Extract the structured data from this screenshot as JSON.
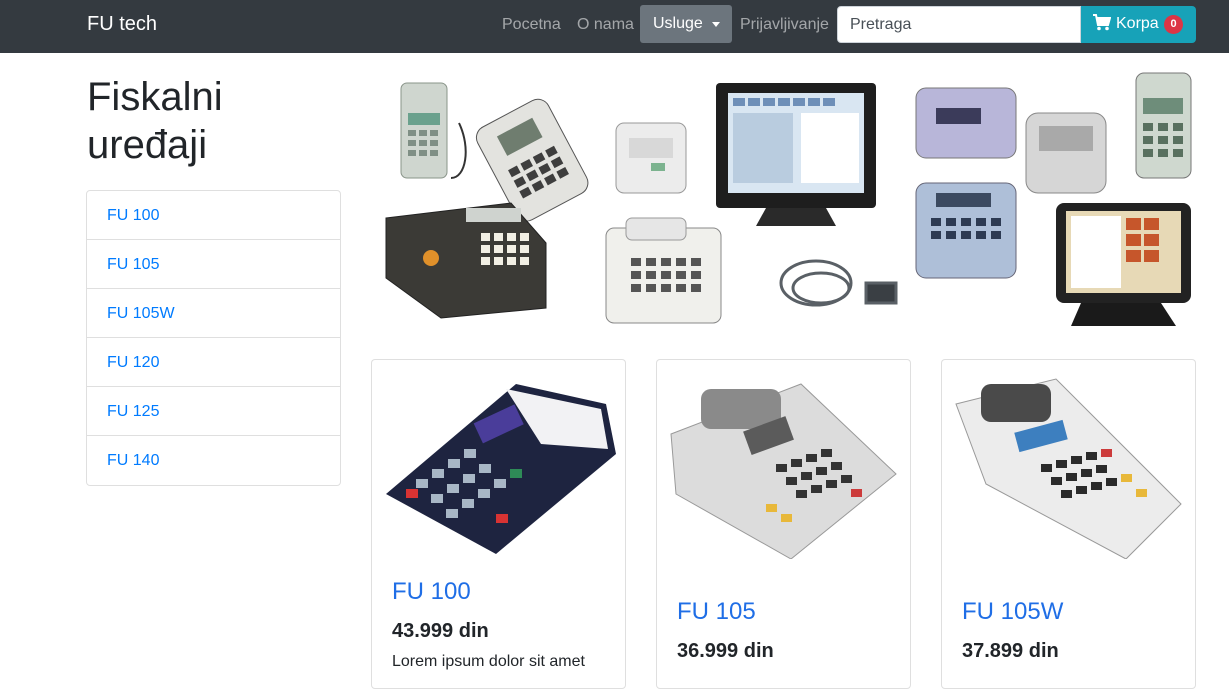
{
  "navbar": {
    "brand": "FU tech",
    "links": [
      "Pocetna",
      "O nama"
    ],
    "dropdown_label": "Usluge",
    "login_label": "Prijavljivanje",
    "search_placeholder": "Pretraga",
    "cart_label": "Korpa",
    "cart_count": "0"
  },
  "sidebar": {
    "title": "Fiskalni uređaji",
    "items": [
      {
        "label": "FU 100"
      },
      {
        "label": "FU 105"
      },
      {
        "label": "FU 105W"
      },
      {
        "label": "FU 120"
      },
      {
        "label": "FU 125"
      },
      {
        "label": "FU 140"
      }
    ]
  },
  "products": [
    {
      "name": "FU 100",
      "price": "43.999 din",
      "description": "Lorem ipsum dolor sit amet"
    },
    {
      "name": "FU 105",
      "price": "36.999 din"
    },
    {
      "name": "FU 105W",
      "price": "37.899 din"
    }
  ],
  "colors": {
    "navbar_bg": "#343a40",
    "link": "#007bff",
    "product_title": "#1f6ee6",
    "cart_button": "#17a2b8",
    "badge": "#dc3545"
  }
}
